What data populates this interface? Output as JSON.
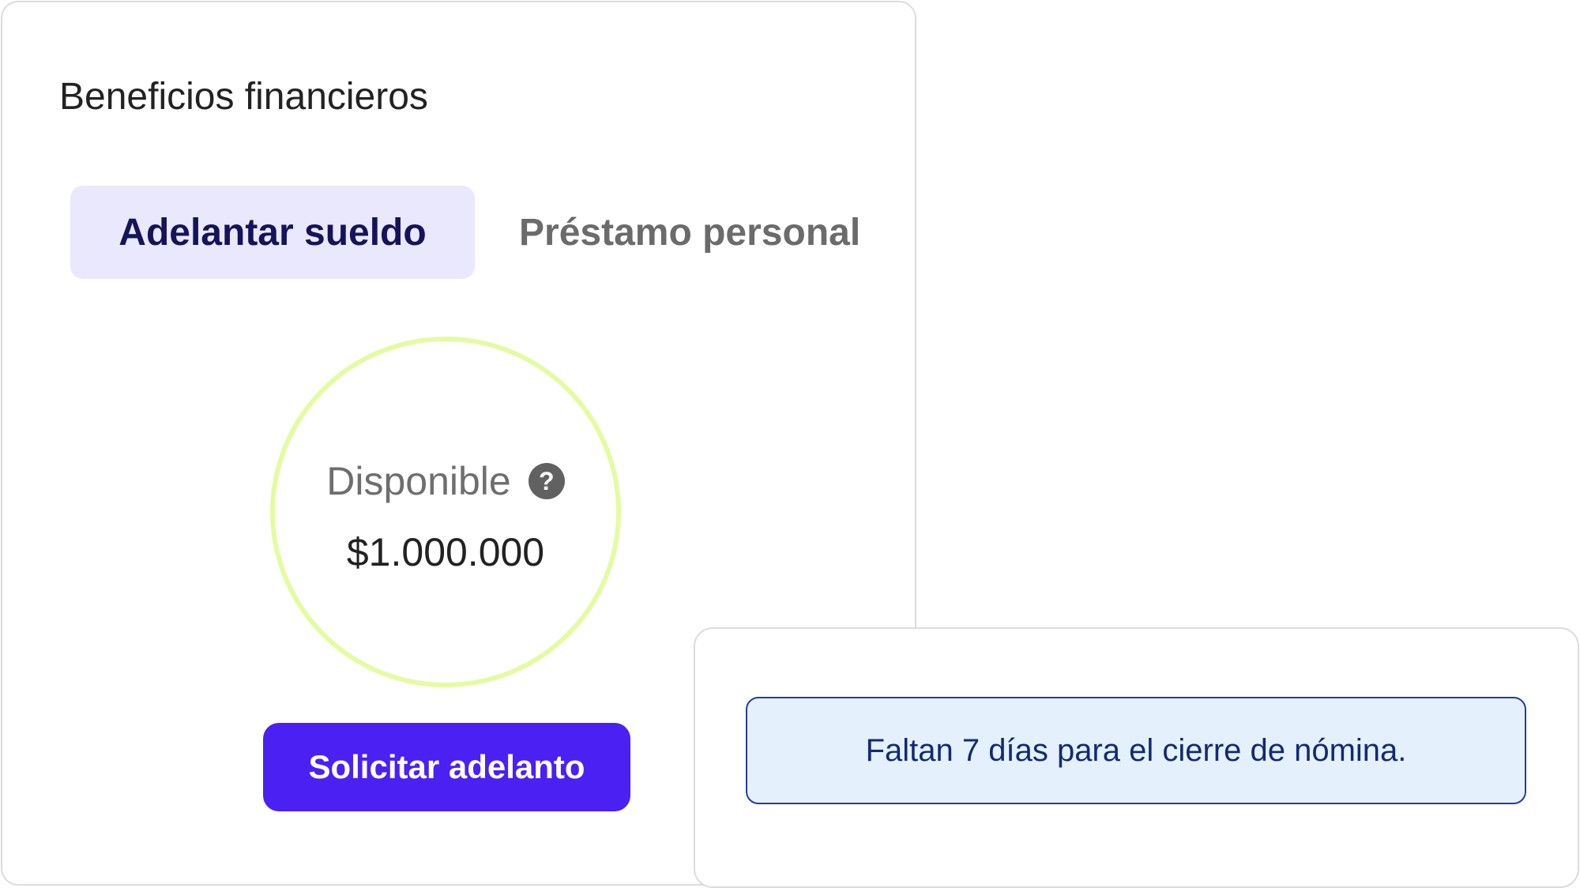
{
  "benefits_card": {
    "title": "Beneficios financieros",
    "tabs": [
      {
        "label": "Adelantar sueldo",
        "active": true
      },
      {
        "label": "Préstamo personal",
        "active": false
      }
    ],
    "balance": {
      "label": "Disponible",
      "help_icon_glyph": "?",
      "amount": "$1.000.000"
    },
    "request_button_label": "Solicitar adelanto"
  },
  "payroll_card": {
    "info_message": "Faltan 7 días para el cierre de nómina."
  },
  "icons": {
    "help": "help-circle-icon"
  },
  "colors": {
    "primary": "#4b20f2",
    "active_tab_bg": "#e9e8fc",
    "active_tab_text": "#16135a",
    "inactive_tab_text": "#6b6b6b",
    "ring": "#e3fca1",
    "info_bg": "#e4f1fd",
    "info_border": "#263c9d",
    "info_text": "#142a70",
    "card_border": "#dcdcdc"
  }
}
